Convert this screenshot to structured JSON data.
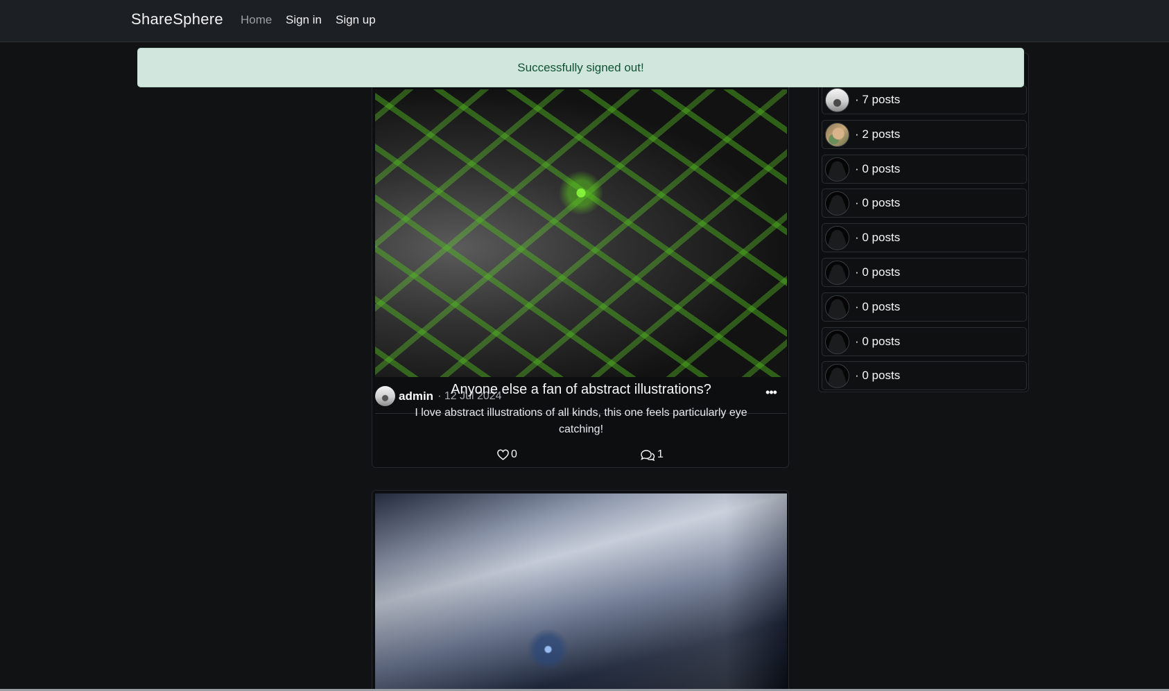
{
  "navbar": {
    "brand": "ShareSphere",
    "links": {
      "home": "Home",
      "sign_in": "Sign in",
      "sign_up": "Sign up"
    }
  },
  "alert": {
    "message": "Successfully signed out!"
  },
  "posts": [
    {
      "author": "admin",
      "date": "· 12 Jul 2024",
      "more": "•••",
      "title": "Anyone else a fan of abstract illustrations?",
      "body": "I love abstract illustrations of all kinds, this one feels particularly eye catching!",
      "likes": "0",
      "comments": "1"
    }
  ],
  "sidebar": {
    "users": [
      {
        "count": "· 7 posts",
        "avatar": "admin-avatar"
      },
      {
        "count": "· 2 posts",
        "avatar": "cat-avatar"
      },
      {
        "count": "· 0 posts",
        "avatar": "default-avatar"
      },
      {
        "count": "· 0 posts",
        "avatar": "default-avatar"
      },
      {
        "count": "· 0 posts",
        "avatar": "default-avatar"
      },
      {
        "count": "· 0 posts",
        "avatar": "default-avatar"
      },
      {
        "count": "· 0 posts",
        "avatar": "default-avatar"
      },
      {
        "count": "· 0 posts",
        "avatar": "default-avatar"
      },
      {
        "count": "· 0 posts",
        "avatar": "default-avatar"
      }
    ]
  },
  "colors": {
    "page_bg": "#111214",
    "navbar_bg": "#1c1f23",
    "alert_bg": "#d1e7dd",
    "alert_text": "#0f5132"
  }
}
